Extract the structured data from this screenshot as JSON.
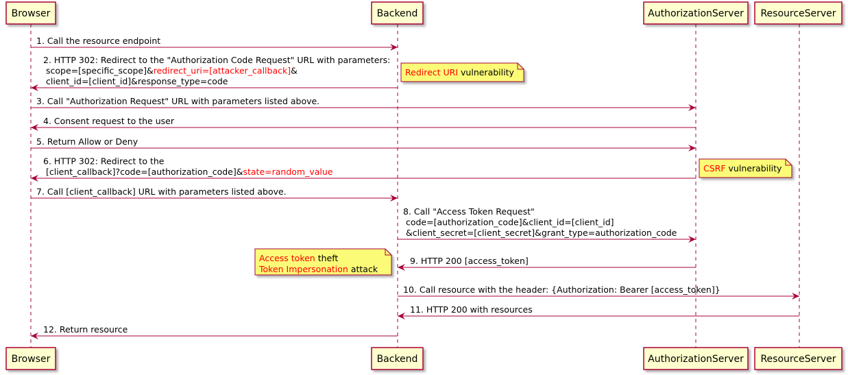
{
  "colors": {
    "participant_fill": "#FEFECE",
    "participant_border": "#A80036",
    "arrow": "#A80036",
    "note_fill": "#FBFB77",
    "highlight": "#FF0000"
  },
  "participants": [
    {
      "id": "browser",
      "label": "Browser"
    },
    {
      "id": "backend",
      "label": "Backend"
    },
    {
      "id": "auth",
      "label": "AuthorizationServer"
    },
    {
      "id": "resource",
      "label": "ResourceServer"
    }
  ],
  "messages": [
    {
      "from": "browser",
      "to": "backend",
      "lines": [
        [
          {
            "t": "1. Call the resource endpoint"
          }
        ]
      ]
    },
    {
      "from": "backend",
      "to": "browser",
      "lines": [
        [
          {
            "t": "2. HTTP 302: Redirect to the \"Authorization Code Request\" URL with parameters:"
          }
        ],
        [
          {
            "t": " scope=[specific_scope]&"
          },
          {
            "t": "redirect_uri=[attacker_callback]",
            "red": true
          },
          {
            "t": "&"
          }
        ],
        [
          {
            "t": " client_id=[client_id]&response_type=code"
          }
        ]
      ]
    },
    {
      "from": "browser",
      "to": "auth",
      "lines": [
        [
          {
            "t": "3. Call \"Authorization Request\" URL with parameters listed above."
          }
        ]
      ]
    },
    {
      "from": "auth",
      "to": "browser",
      "lines": [
        [
          {
            "t": "4. Consent request to the user"
          }
        ]
      ]
    },
    {
      "from": "browser",
      "to": "auth",
      "lines": [
        [
          {
            "t": "5. Return Allow or Deny"
          }
        ]
      ]
    },
    {
      "from": "auth",
      "to": "browser",
      "lines": [
        [
          {
            "t": "6. HTTP 302: Redirect to the"
          }
        ],
        [
          {
            "t": " [client_callback]?code=[authorization_code]&"
          },
          {
            "t": "state=random_value",
            "red": true
          }
        ]
      ]
    },
    {
      "from": "browser",
      "to": "backend",
      "lines": [
        [
          {
            "t": "7. Call [client_callback] URL with parameters listed above."
          }
        ]
      ]
    },
    {
      "from": "backend",
      "to": "auth",
      "lines": [
        [
          {
            "t": "8. Call \"Access Token Request\""
          }
        ],
        [
          {
            "t": " code=[authorization_code]&client_id=[client_id]"
          }
        ],
        [
          {
            "t": " &client_secret=[client_secret]&grant_type=authorization_code"
          }
        ]
      ]
    },
    {
      "from": "auth",
      "to": "backend",
      "lines": [
        [
          {
            "t": "9. HTTP 200 [access_token]"
          }
        ]
      ]
    },
    {
      "from": "backend",
      "to": "resource",
      "lines": [
        [
          {
            "t": "10. Call resource with the header: {Authorization: Bearer [access_token]}"
          }
        ]
      ]
    },
    {
      "from": "resource",
      "to": "backend",
      "lines": [
        [
          {
            "t": "11. HTTP 200 with resources"
          }
        ]
      ]
    },
    {
      "from": "backend",
      "to": "browser",
      "lines": [
        [
          {
            "t": "12. Return resource"
          }
        ]
      ]
    }
  ],
  "notes": [
    {
      "name": "redirect-uri-note",
      "lines": [
        [
          {
            "t": "Redirect URI",
            "red": true
          },
          {
            "t": " vulnerability"
          }
        ]
      ]
    },
    {
      "name": "csrf-note",
      "lines": [
        [
          {
            "t": "CSRF",
            "red": true
          },
          {
            "t": " vulnerability"
          }
        ]
      ]
    },
    {
      "name": "access-token-note",
      "lines": [
        [
          {
            "t": "Access token",
            "red": true
          },
          {
            "t": " theft"
          }
        ],
        [
          {
            "t": "Token Impersonation",
            "red": true
          },
          {
            "t": " attack"
          }
        ]
      ]
    }
  ]
}
